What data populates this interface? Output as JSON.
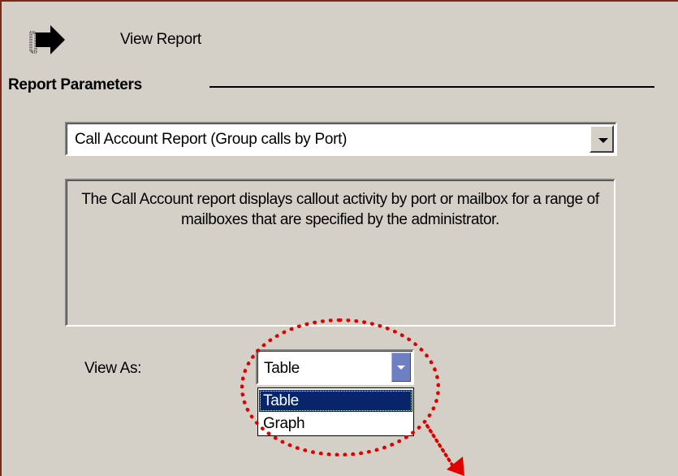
{
  "toolbar": {
    "view_report_label": "View Report",
    "icon": "arrow-right-icon"
  },
  "section": {
    "title": "Report Parameters"
  },
  "report_select": {
    "selected": "Call Account Report (Group calls by Port)"
  },
  "description": {
    "text": "The Call Account report displays callout activity by port or mailbox for a range of mailboxes that are specified by the administrator."
  },
  "view_as": {
    "label": "View As:",
    "selected": "Table",
    "options": [
      "Table",
      "Graph"
    ]
  },
  "annotation": {
    "color": "#e00000"
  }
}
